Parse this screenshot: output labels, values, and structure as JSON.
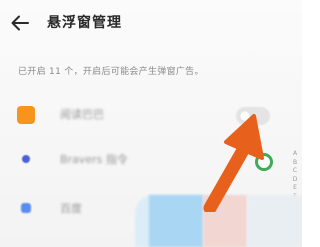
{
  "header": {
    "title": "悬浮窗管理",
    "back_icon": "back-arrow-icon"
  },
  "summary_text": "已开启 11 个，开启后可能会产生弹窗广告。",
  "apps": [
    {
      "label": "阅读巴巴",
      "icon_color": "#f7941d",
      "toggle_state": "off"
    },
    {
      "label": "Bravers 指令",
      "icon_color": "#4a5fd8",
      "toggle_state": "on"
    },
    {
      "label": "百度",
      "icon_color": "#5b8cf0",
      "toggle_state": "unknown"
    }
  ],
  "alpha_index": [
    "A",
    "B",
    "C",
    "D",
    "E",
    "F",
    "G",
    "H"
  ],
  "colors": {
    "accent_toggle_on": "#3eaa5a",
    "annotation_arrow": "#e8611c",
    "dock_blue": "#a9d6f2",
    "dock_pink": "#f2d6d2"
  }
}
